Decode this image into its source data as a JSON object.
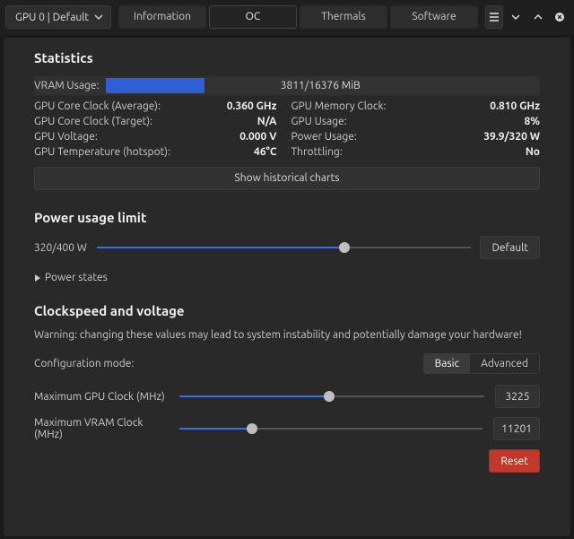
{
  "toolbar": {
    "gpu_label": "GPU 0 | Default",
    "tabs": [
      "Information",
      "OC",
      "Thermals",
      "Software"
    ],
    "active_tab": 1
  },
  "statistics": {
    "title": "Statistics",
    "vram_label": "VRAM Usage:",
    "vram_text": "3811/16376 MiB",
    "vram_pct": 23,
    "rows_left": [
      {
        "l": "GPU Core Clock (Average):",
        "v": "0.360 GHz"
      },
      {
        "l": "GPU Core Clock (Target):",
        "v": "N/A"
      },
      {
        "l": "GPU Voltage:",
        "v": "0.000 V"
      },
      {
        "l": "GPU Temperature (hotspot):",
        "v": "46°C"
      }
    ],
    "rows_right": [
      {
        "l": "GPU Memory Clock:",
        "v": "0.810 GHz"
      },
      {
        "l": "GPU Usage:",
        "v": "8%"
      },
      {
        "l": "Power Usage:",
        "v": "39.9/320 W"
      },
      {
        "l": "Throttling:",
        "v": "No"
      }
    ],
    "historical_btn": "Show historical charts"
  },
  "power": {
    "title": "Power usage limit",
    "value_label": "320/400 W",
    "slider_pct": 66,
    "default_btn": "Default",
    "power_states": "Power states"
  },
  "clock": {
    "title": "Clockspeed and voltage",
    "warning": "Warning: changing these values may lead to system instability and potentially damage your hardware!",
    "config_label": "Configuration mode:",
    "mode_basic": "Basic",
    "mode_advanced": "Advanced",
    "active_mode": "Basic",
    "gpu_clock_label": "Maximum GPU Clock (MHz)",
    "gpu_clock_value": "3225",
    "gpu_clock_pct": 49,
    "vram_clock_label": "Maximum VRAM Clock (MHz)",
    "vram_clock_value": "11201",
    "vram_clock_pct": 24,
    "reset_btn": "Reset"
  }
}
